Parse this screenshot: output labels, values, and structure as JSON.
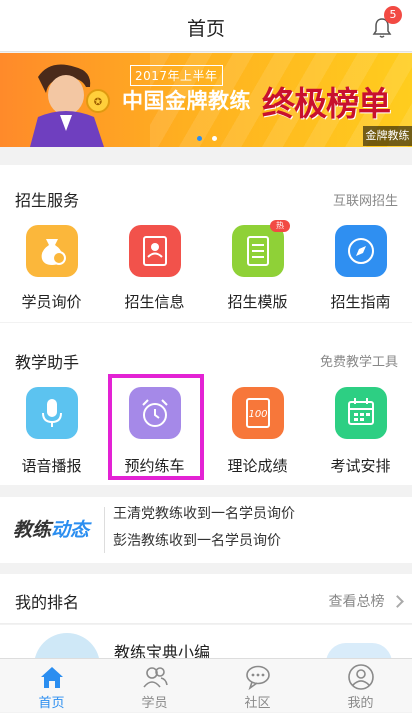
{
  "header": {
    "title": "首页",
    "notification_count": "5"
  },
  "banner": {
    "subtitle": "2017年上半年",
    "title": "中国金牌教练",
    "headline": "终极榜单",
    "corner_label": "金牌教练",
    "total_slides": 2,
    "active_slide": 1
  },
  "enrollment": {
    "title": "招生服务",
    "link": "互联网招生",
    "items": [
      {
        "label": "学员询价",
        "icon": "money-bag-icon",
        "color": "#fbb73b"
      },
      {
        "label": "招生信息",
        "icon": "id-card-icon",
        "color": "#f2524b"
      },
      {
        "label": "招生模版",
        "icon": "document-icon",
        "color": "#8fd137",
        "badge": "热"
      },
      {
        "label": "招生指南",
        "icon": "compass-icon",
        "color": "#2f8ff1"
      }
    ]
  },
  "teaching": {
    "title": "教学助手",
    "link": "免费教学工具",
    "items": [
      {
        "label": "语音播报",
        "icon": "microphone-icon",
        "color": "#5cc3f0"
      },
      {
        "label": "预约练车",
        "icon": "alarm-clock-icon",
        "color": "#a589e8"
      },
      {
        "label": "理论成绩",
        "icon": "score-sheet-icon",
        "color": "#f7773a"
      },
      {
        "label": "考试安排",
        "icon": "calendar-icon",
        "color": "#2dcf83"
      }
    ]
  },
  "news": {
    "logo_part1": "教练",
    "logo_part2": "动态",
    "lines": [
      "王清党教练收到一名学员询价",
      "彭浩教练收到一名学员询价"
    ]
  },
  "ranking": {
    "title": "我的排名",
    "link": "查看总榜",
    "row_name": "教练宝典小编"
  },
  "tabbar": {
    "active_color": "#2b8ef0",
    "inactive_color": "#8a8a8a",
    "tabs": [
      {
        "label": "首页",
        "icon": "home-icon",
        "active": true
      },
      {
        "label": "学员",
        "icon": "students-icon",
        "active": false
      },
      {
        "label": "社区",
        "icon": "chat-bubble-icon",
        "active": false
      },
      {
        "label": "我的",
        "icon": "profile-icon",
        "active": false
      }
    ]
  }
}
